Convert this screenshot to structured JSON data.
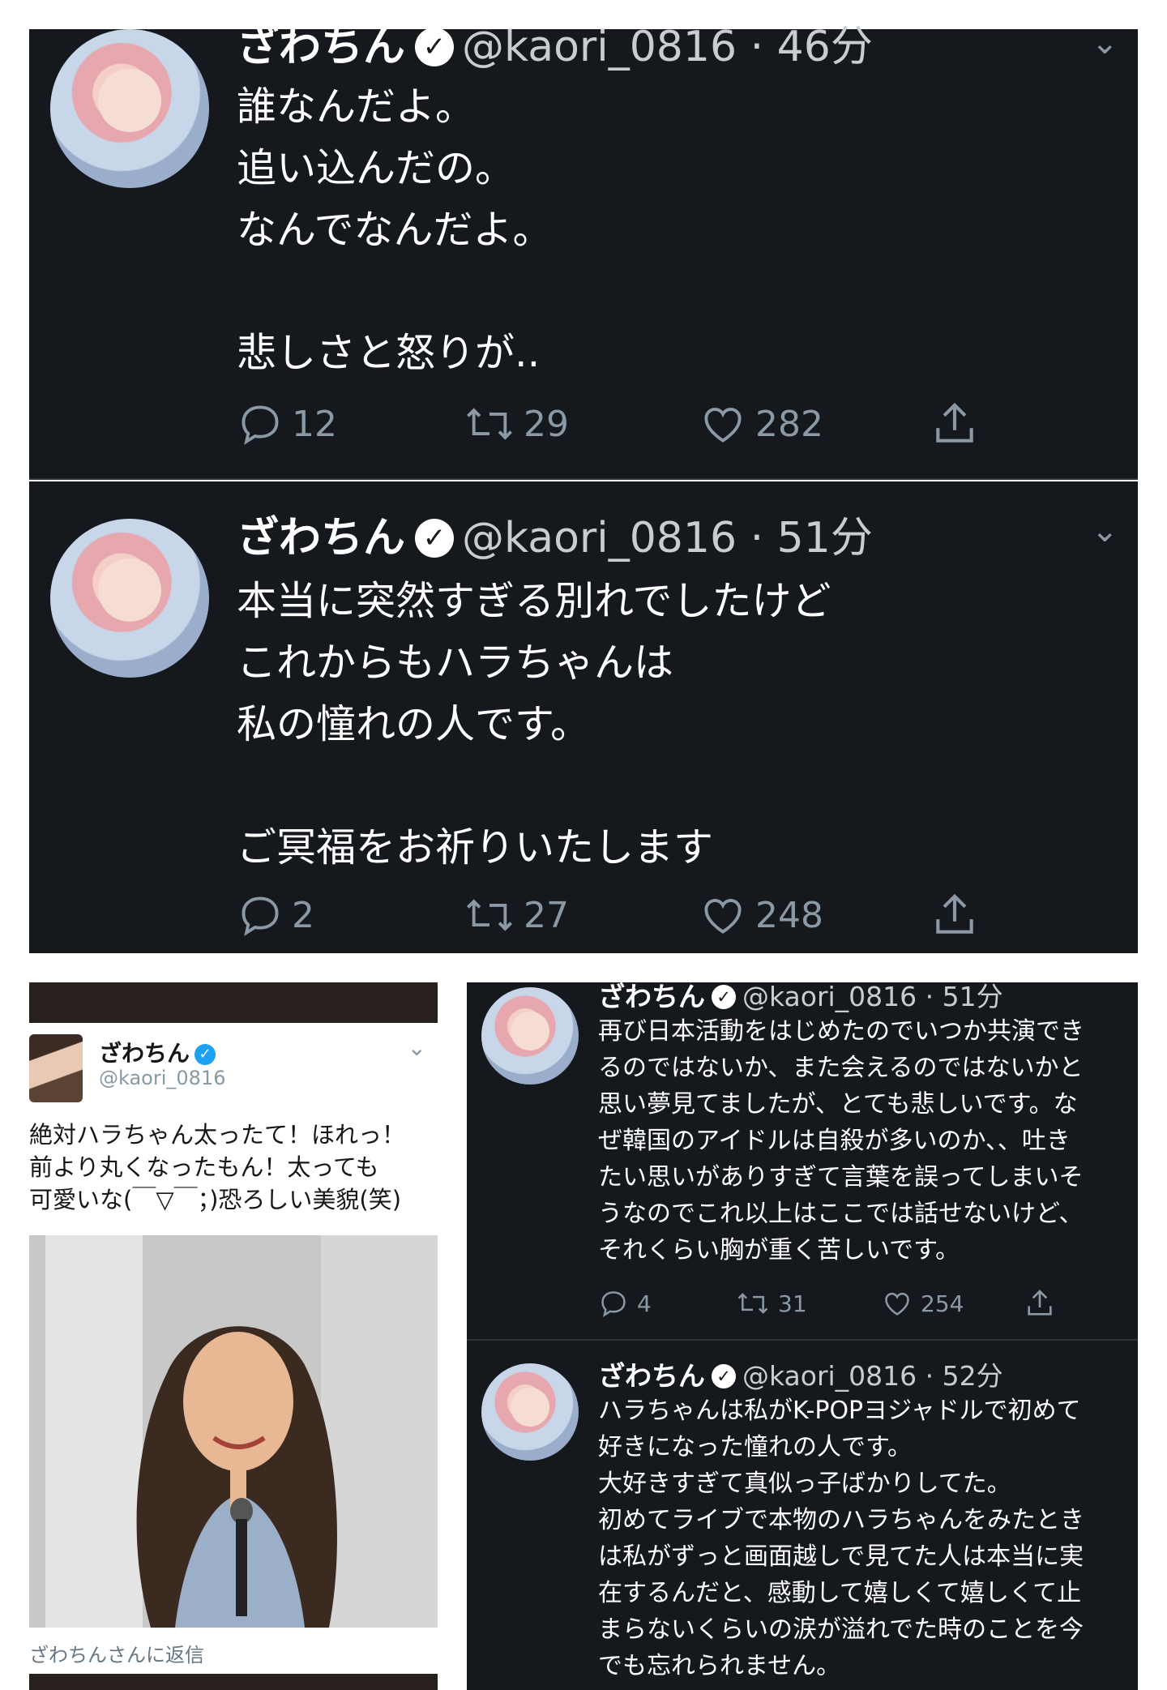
{
  "tweets_top": [
    {
      "name": "ざわちん",
      "handle": "@kaori_0816",
      "time": "· 46分",
      "text": "誰なんだよ。\n追い込んだの。\nなんでなんだよ。\n\n悲しさと怒りが..",
      "replies": "12",
      "retweets": "29",
      "likes": "282"
    },
    {
      "name": "ざわちん",
      "handle": "@kaori_0816",
      "time": "· 51分",
      "text": "本当に突然すぎる別れでしたけど\nこれからもハラちゃんは\n私の憧れの人です。\n\nご冥福をお祈りいたします",
      "replies": "2",
      "retweets": "27",
      "likes": "248"
    }
  ],
  "reply_card": {
    "name": "ざわちん",
    "handle": "@kaori_0816",
    "text": "絶対ハラちゃん太ったて！ほれっ！\n前より丸くなったもん！太っても\n可愛いな(￣▽￣；)恐ろしい美貌(笑)",
    "reply_note": "ざわちんさんに返信"
  },
  "tweets_right": [
    {
      "name": "ざわちん",
      "handle": "@kaori_0816",
      "time": "· 51分",
      "text": "再び日本活動をはじめたのでいつか共演でき\nるのではないか、また会えるのではないかと\n思い夢見てましたが、とても悲しいです。な\nぜ韓国のアイドルは自殺が多いのか、、吐き\nたい思いがありすぎて言葉を誤ってしまいそ\nうなのでこれ以上はここでは話せないけど、\nそれくらい胸が重く苦しいです。",
      "replies": "4",
      "retweets": "31",
      "likes": "254"
    },
    {
      "name": "ざわちん",
      "handle": "@kaori_0816",
      "time": "· 52分",
      "text": "ハラちゃんは私がK-POPヨジャドルで初めて\n好きになった憧れの人です。\n大好きすぎて真似っ子ばかりしてた。\n初めてライブで本物のハラちゃんをみたとき\nは私がずっと画面越しで見てた人は本当に実\n在するんだと、感動して嬉しくて嬉しくて止\nまらないくらいの涙が溢れでた時のことを今\nでも忘れられません。"
    }
  ],
  "colors": {
    "dark_bg": "#15181c",
    "muted": "#8b98a5",
    "verified_blue": "#1da1f2"
  },
  "icons": [
    "reply-icon",
    "retweet-icon",
    "like-icon",
    "share-icon",
    "verified-badge-icon",
    "chevron-down-icon"
  ]
}
